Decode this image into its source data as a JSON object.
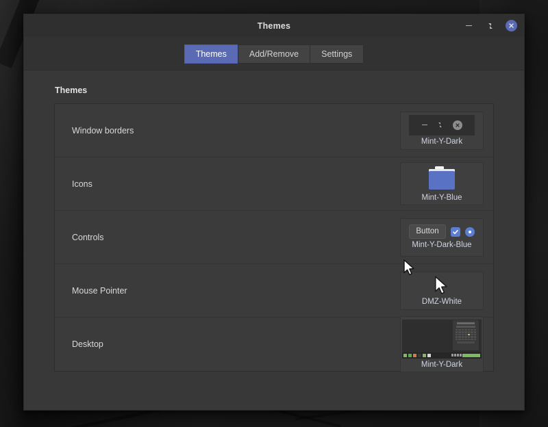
{
  "window": {
    "title": "Themes",
    "controls": {
      "minimize": "minimize",
      "maximize": "maximize",
      "close": "close"
    }
  },
  "toolbar": {
    "tabs": [
      {
        "label": "Themes",
        "active": true
      },
      {
        "label": "Add/Remove",
        "active": false
      },
      {
        "label": "Settings",
        "active": false
      }
    ]
  },
  "content": {
    "section_title": "Themes",
    "rows": [
      {
        "label": "Window borders",
        "value": "Mint-Y-Dark",
        "preview": "window-borders"
      },
      {
        "label": "Icons",
        "value": "Mint-Y-Blue",
        "preview": "folder"
      },
      {
        "label": "Controls",
        "value": "Mint-Y-Dark-Blue",
        "preview": "controls"
      },
      {
        "label": "Mouse Pointer",
        "value": "DMZ-White",
        "preview": "cursor"
      },
      {
        "label": "Desktop",
        "value": "Mint-Y-Dark",
        "preview": "desktop"
      }
    ],
    "controls_preview": {
      "button_label": "Button",
      "checkbox_checked": true,
      "radio_selected": true
    }
  },
  "colors": {
    "accent_blue": "#5b6ab4",
    "control_blue": "#5b7ed0",
    "folder_blue": "#5a72c4",
    "window_bg": "#383838",
    "titlebar_bg": "#2f2f2f",
    "list_bg": "#3b3b3b",
    "text": "#d9d9d9",
    "desktop_accent_green": "#7fbb5e"
  }
}
